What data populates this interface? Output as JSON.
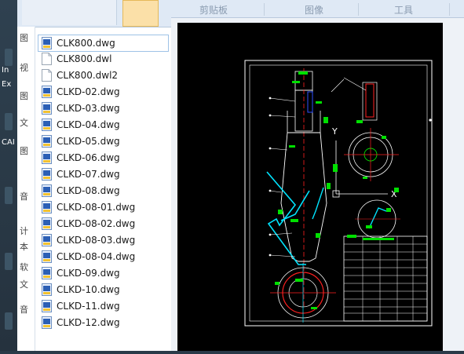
{
  "desktop": {
    "labels": [
      "In",
      "Ex",
      "CAI"
    ]
  },
  "explorer": {
    "nav_chars": [
      "图",
      "视",
      "图",
      "文",
      "图",
      "音",
      "计",
      "本",
      "软",
      "文",
      "音"
    ],
    "files": [
      {
        "name": "CLK800.dwg",
        "icon": "dwg-icon",
        "selected": true
      },
      {
        "name": "CLK800.dwl",
        "icon": "blank-file-icon",
        "selected": false
      },
      {
        "name": "CLK800.dwl2",
        "icon": "blank-file-icon",
        "selected": false
      },
      {
        "name": "CLKD-02.dwg",
        "icon": "dwg-icon",
        "selected": false
      },
      {
        "name": "CLKD-03.dwg",
        "icon": "dwg-icon",
        "selected": false
      },
      {
        "name": "CLKD-04.dwg",
        "icon": "dwg-icon",
        "selected": false
      },
      {
        "name": "CLKD-05.dwg",
        "icon": "dwg-icon",
        "selected": false
      },
      {
        "name": "CLKD-06.dwg",
        "icon": "dwg-icon",
        "selected": false
      },
      {
        "name": "CLKD-07.dwg",
        "icon": "dwg-icon",
        "selected": false
      },
      {
        "name": "CLKD-08.dwg",
        "icon": "dwg-icon",
        "selected": false
      },
      {
        "name": "CLKD-08-01.dwg",
        "icon": "dwg-icon",
        "selected": false
      },
      {
        "name": "CLKD-08-02.dwg",
        "icon": "dwg-icon",
        "selected": false
      },
      {
        "name": "CLKD-08-03.dwg",
        "icon": "dwg-icon",
        "selected": false
      },
      {
        "name": "CLKD-08-04.dwg",
        "icon": "dwg-icon",
        "selected": false
      },
      {
        "name": "CLKD-09.dwg",
        "icon": "dwg-icon",
        "selected": false
      },
      {
        "name": "CLKD-10.dwg",
        "icon": "dwg-icon",
        "selected": false
      },
      {
        "name": "CLKD-11.dwg",
        "icon": "dwg-icon",
        "selected": false
      },
      {
        "name": "CLKD-12.dwg",
        "icon": "dwg-icon",
        "selected": false
      }
    ]
  },
  "ribbon": {
    "tabs": [
      "剪贴板",
      "图像",
      "工具"
    ]
  },
  "preview": {
    "axis_y_label": "Y",
    "axis_x_label": "X"
  },
  "colors": {
    "accent_selection": "#9ec2e6",
    "cad_background": "#000000",
    "cad_white": "#ffffff",
    "cad_green": "#00e000",
    "cad_cyan": "#00e5ff",
    "cad_red": "#ff2020",
    "cad_blue": "#3050ff"
  }
}
